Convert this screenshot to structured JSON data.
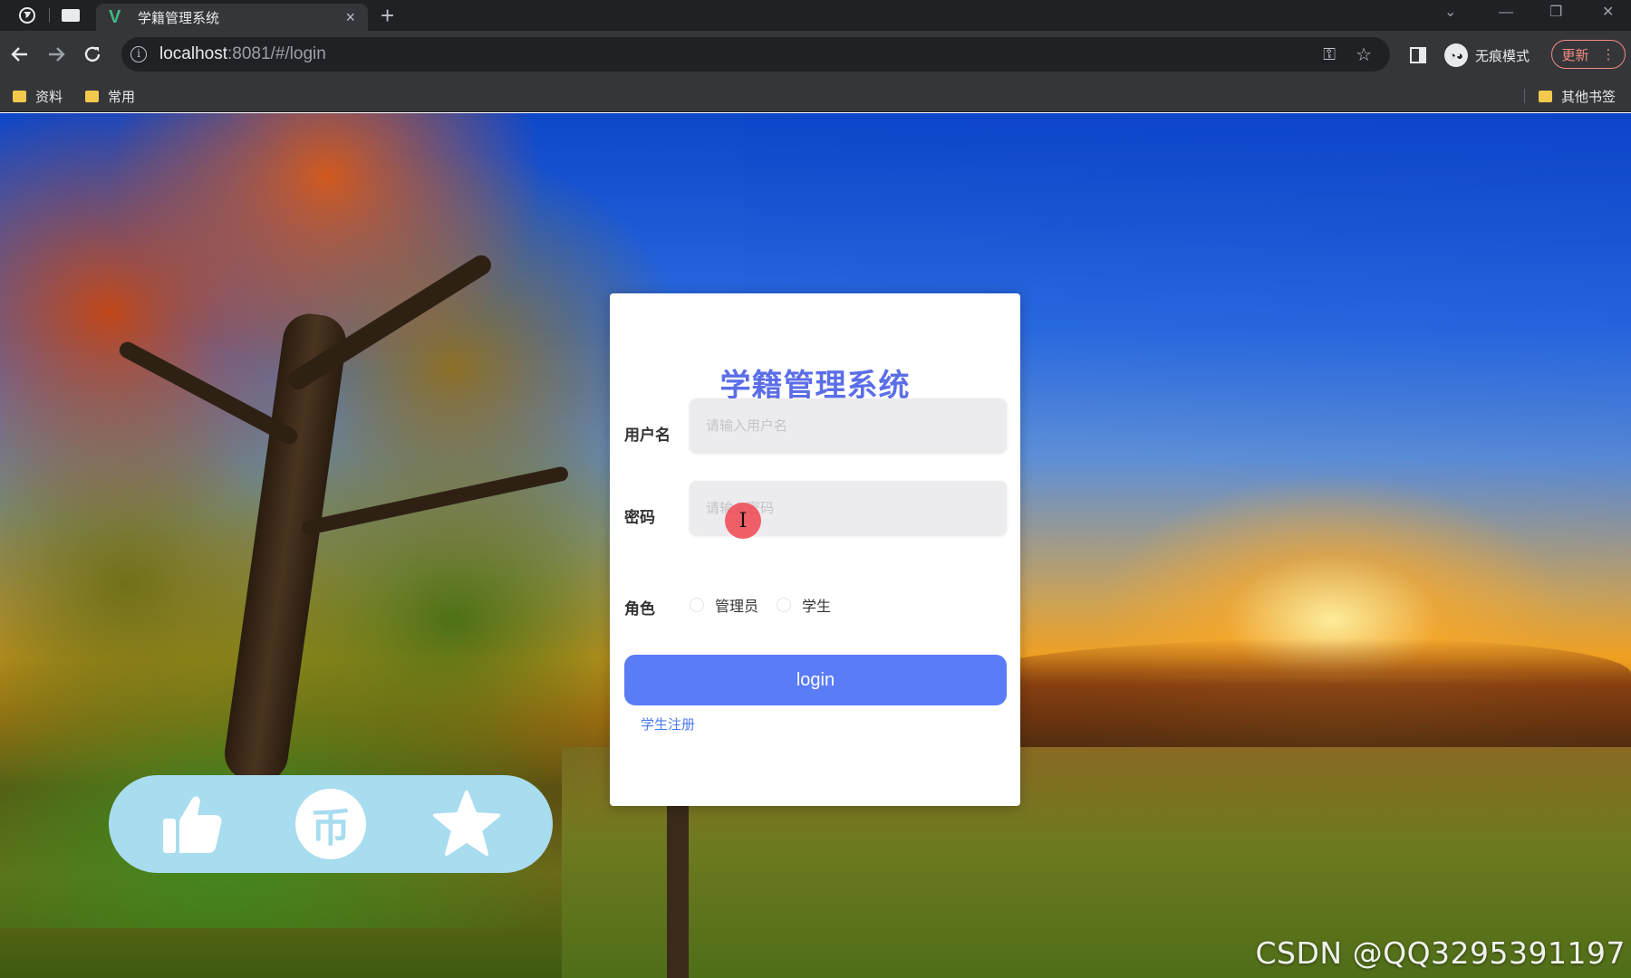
{
  "browser": {
    "tab_title": "学籍管理系统",
    "tab_close": "×",
    "new_tab": "+",
    "url_host": "localhost",
    "url_rest": ":8081/#/login",
    "incognito_label": "无痕模式",
    "update_label": "更新",
    "menu_dots": "⋮",
    "bookmarks": [
      {
        "label": "资料"
      },
      {
        "label": "常用"
      }
    ],
    "other_bookmarks": "其他书签"
  },
  "login": {
    "title": "学籍管理系统",
    "username_label": "用户名",
    "username_placeholder": "请输入用户名",
    "password_label": "密码",
    "password_placeholder": "请输入密码",
    "role_label": "角色",
    "roles": [
      {
        "label": "管理员"
      },
      {
        "label": "学生"
      }
    ],
    "login_button": "login",
    "register_link": "学生注册"
  },
  "cursor_glyph": "I",
  "actions": {
    "like_icon": "thumbs-up-icon",
    "coin_icon": "coin-icon",
    "coin_glyph": "币",
    "favorite_icon": "star-icon"
  },
  "watermark": "CSDN @QQ3295391197",
  "colors": {
    "title_accent": "#5b6ee8",
    "login_button": "#5b7cf7",
    "action_pill": "#a8dcef"
  }
}
